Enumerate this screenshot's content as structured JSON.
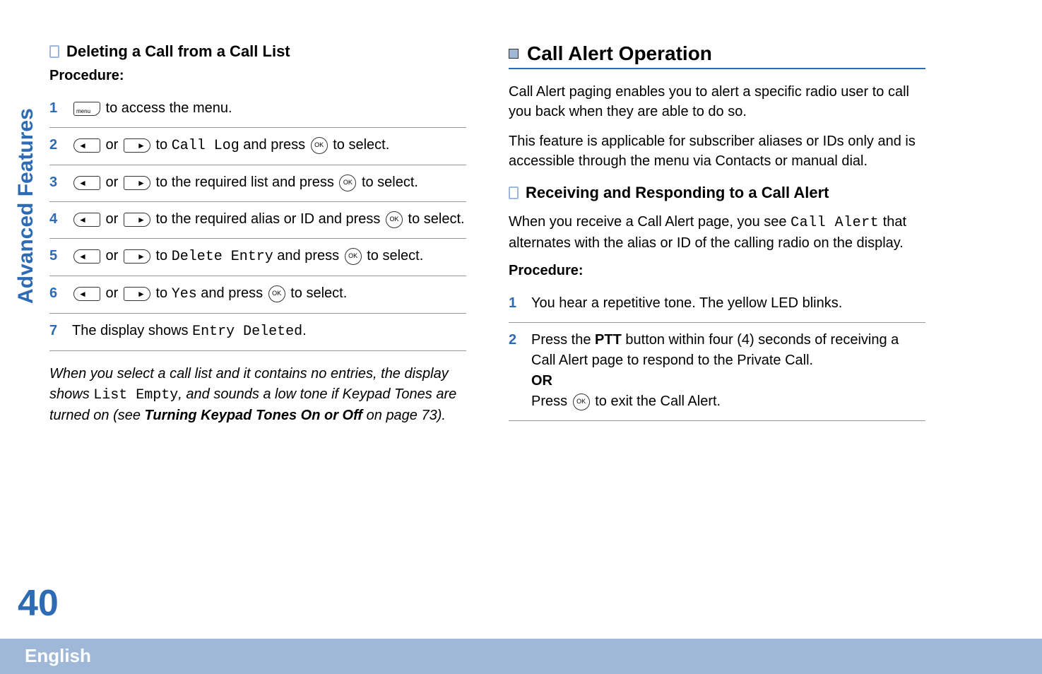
{
  "sidebar_label": "Advanced Features",
  "page_number": "40",
  "footer_language": "English",
  "left": {
    "heading": "Deleting a Call from a Call List",
    "procedure_label": "Procedure:",
    "steps": {
      "s1_num": "1",
      "s1_a": " to access the menu.",
      "s2_num": "2",
      "s2_a": " or ",
      "s2_b": " to ",
      "s2_mono": "Call Log",
      "s2_c": " and press ",
      "s2_d": " to select.",
      "s3_num": "3",
      "s3_a": " or ",
      "s3_b": " to the required list and press ",
      "s3_c": " to select.",
      "s4_num": "4",
      "s4_a": " or ",
      "s4_b": " to the required alias or ID and press ",
      "s4_c": " to select.",
      "s5_num": "5",
      "s5_a": " or ",
      "s5_b": " to ",
      "s5_mono": "Delete Entry",
      "s5_c": " and press ",
      "s5_d": " to select.",
      "s6_num": "6",
      "s6_a": " or ",
      "s6_b": " to ",
      "s6_mono": "Yes",
      "s6_c": " and press ",
      "s6_d": " to select.",
      "s7_num": "7",
      "s7_a": "The display shows ",
      "s7_mono": "Entry Deleted",
      "s7_b": "."
    },
    "note_a": "When you select a call list and it contains no entries, the display shows ",
    "note_mono": "List Empty",
    "note_b": ", and sounds a low tone if Keypad Tones are turned on (see ",
    "note_bold": "Turning Keypad Tones On or Off",
    "note_c": " on page 73)."
  },
  "right": {
    "section_title": "Call Alert Operation",
    "intro1": "Call Alert paging enables you to alert a specific radio user to call you back when they are able to do so.",
    "intro2": "This feature is applicable for subscriber aliases or IDs only and is accessible through the menu via Contacts or manual dial.",
    "subheading": "Receiving and Responding to a Call Alert",
    "sub_intro_a": "When you receive a Call Alert page, you see ",
    "sub_intro_mono": "Call Alert",
    "sub_intro_b": " that alternates with the alias or ID of the calling radio on the display.",
    "procedure_label": "Procedure:",
    "steps": {
      "s1_num": "1",
      "s1_a": "You hear a repetitive tone. The yellow LED blinks.",
      "s2_num": "2",
      "s2_a": "Press the ",
      "s2_bold": "PTT",
      "s2_b": " button within four (4) seconds of receiving a Call Alert page to respond to the Private Call.",
      "s2_or": "OR",
      "s2_c": "Press ",
      "s2_d": " to exit the Call Alert."
    }
  }
}
